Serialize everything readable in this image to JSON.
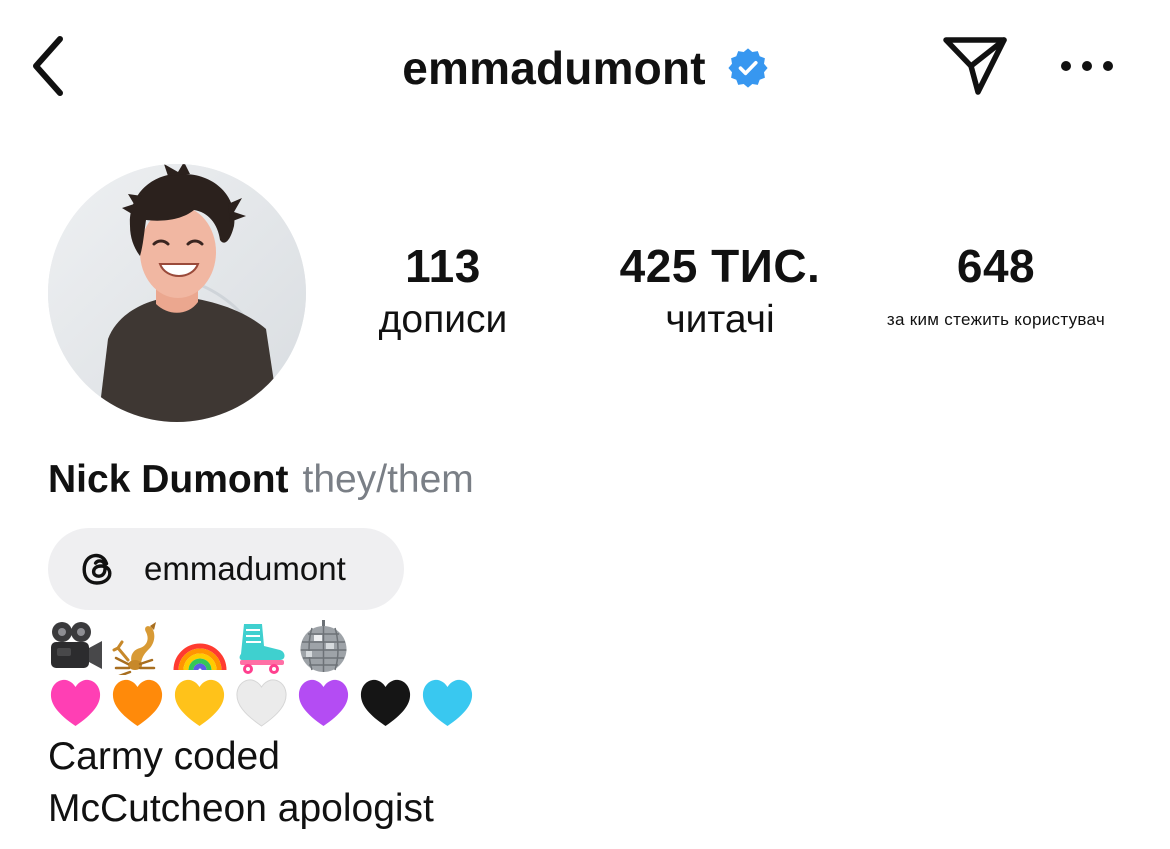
{
  "header": {
    "username": "emmadumont",
    "verified": true,
    "accent_color": "#3797f0"
  },
  "icons": {
    "back": "chevron-left-icon",
    "verified": "verified-badge-icon",
    "send": "paper-plane-icon",
    "more": "more-horizontal-icon",
    "threads": "threads-logo-icon"
  },
  "stats": {
    "posts": {
      "value": "113",
      "label": "дописи"
    },
    "followers": {
      "value": "425 ТИС.",
      "label": "читачі"
    },
    "following": {
      "value": "648",
      "label": "за ким стежить користувач"
    }
  },
  "profile": {
    "name": "Nick Dumont",
    "pronouns": "they/them",
    "threads_handle": "emmadumont"
  },
  "bio": {
    "emoji_line_1": [
      "movie-camera",
      "scorpion",
      "rainbow",
      "roller-skate",
      "mirror-ball"
    ],
    "emoji_line_2": [
      "pink-heart",
      "orange-heart",
      "yellow-heart",
      "white-heart",
      "purple-heart",
      "black-heart",
      "light-blue-heart"
    ],
    "line_1": "Carmy coded",
    "line_2": "McCutcheon apologist"
  },
  "colors": {
    "text": "#111111",
    "muted": "#7a7f86",
    "chip_bg": "#efeff1",
    "pink": "#ff3fb4",
    "orange": "#ff8a0a",
    "yellow": "#ffc21a",
    "white_heart": "#eaeaea",
    "purple": "#b44cf3",
    "black": "#151515",
    "light_blue": "#39c8f0"
  }
}
